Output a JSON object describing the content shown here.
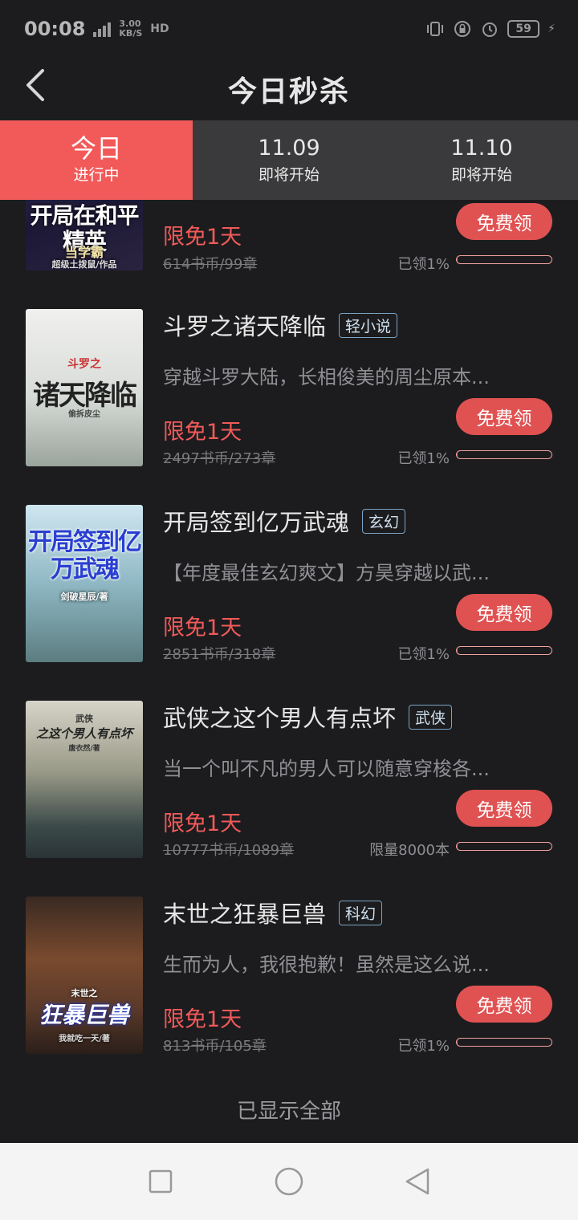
{
  "status_bar": {
    "time": "00:08",
    "network": "4G",
    "speed_value": "3.00",
    "speed_unit": "KB/S",
    "hd": "HD",
    "battery": "59"
  },
  "header": {
    "title": "今日秒杀"
  },
  "tabs": [
    {
      "label": "今日",
      "sub": "进行中",
      "active": true
    },
    {
      "label": "11.09",
      "sub": "即将开始",
      "active": false
    },
    {
      "label": "11.10",
      "sub": "即将开始",
      "active": false
    }
  ],
  "books": [
    {
      "title": "",
      "genre": "",
      "desc": "",
      "free": "限免1天",
      "price": "614书币/99章",
      "claimed": "已领1%",
      "progress": 0.01,
      "button": "免费领",
      "cover_text": "开局在和平精英",
      "cover_sub": "当学霸",
      "cover_author": "超级土拨鼠/作品"
    },
    {
      "title": "斗罗之诸天降临",
      "genre": "轻小说",
      "desc": "穿越斗罗大陆，长相俊美的周尘原本...",
      "free": "限免1天",
      "price": "2497书币/273章",
      "claimed": "已领1%",
      "progress": 0.01,
      "button": "免费领",
      "cover_text": "诸天降临",
      "cover_sub": "斗罗之",
      "cover_author": "偷拆皮尘"
    },
    {
      "title": "开局签到亿万武魂",
      "genre": "玄幻",
      "desc": "【年度最佳玄幻爽文】方昊穿越以武...",
      "free": "限免1天",
      "price": "2851书币/318章",
      "claimed": "已领1%",
      "progress": 0.01,
      "button": "免费领",
      "cover_text": "开局签到亿万武魂",
      "cover_sub": "",
      "cover_author": "剑破星辰/著"
    },
    {
      "title": "武侠之这个男人有点坏",
      "genre": "武侠",
      "desc": "当一个叫不凡的男人可以随意穿梭各...",
      "free": "限免1天",
      "price": "10777书币/1089章",
      "claimed": "限量8000本",
      "progress": 0.01,
      "button": "免费领",
      "cover_text": "之这个男人有点坏",
      "cover_sub": "武侠",
      "cover_author": "唐衣然/著"
    },
    {
      "title": "末世之狂暴巨兽",
      "genre": "科幻",
      "desc": "生而为人，我很抱歉！虽然是这么说...",
      "free": "限免1天",
      "price": "813书币/105章",
      "claimed": "已领1%",
      "progress": 0.01,
      "button": "免费领",
      "cover_text": "狂暴巨兽",
      "cover_sub": "末世之",
      "cover_author": "我就吃一天/著"
    }
  ],
  "footer": {
    "text": "已显示全部"
  },
  "colors": {
    "accent": "#f25a5a",
    "button": "#e05252",
    "background": "#1c1c1e",
    "tab_bg": "#3a3a3c"
  }
}
